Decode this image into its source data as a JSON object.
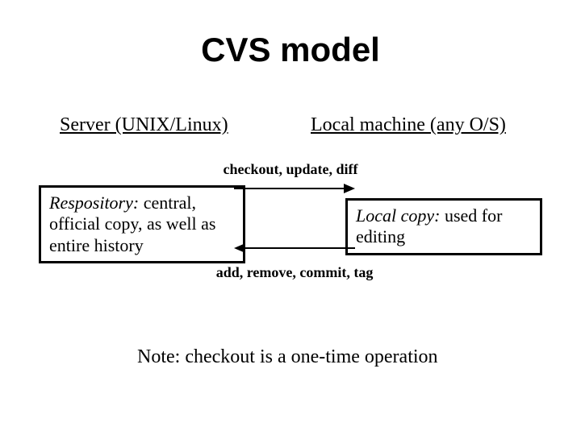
{
  "title": "CVS model",
  "left_heading": "Server (UNIX/Linux)",
  "right_heading": "Local machine (any O/S)",
  "top_arrow_label": "checkout, update, diff",
  "bottom_arrow_label": "add, remove, commit, tag",
  "left_box": {
    "lead": "Respository:",
    "rest": "  central, official copy, as well as entire history"
  },
  "right_box": {
    "lead": "Local copy:",
    "rest": "  used for editing"
  },
  "note": "Note:  checkout is a one-time operation"
}
